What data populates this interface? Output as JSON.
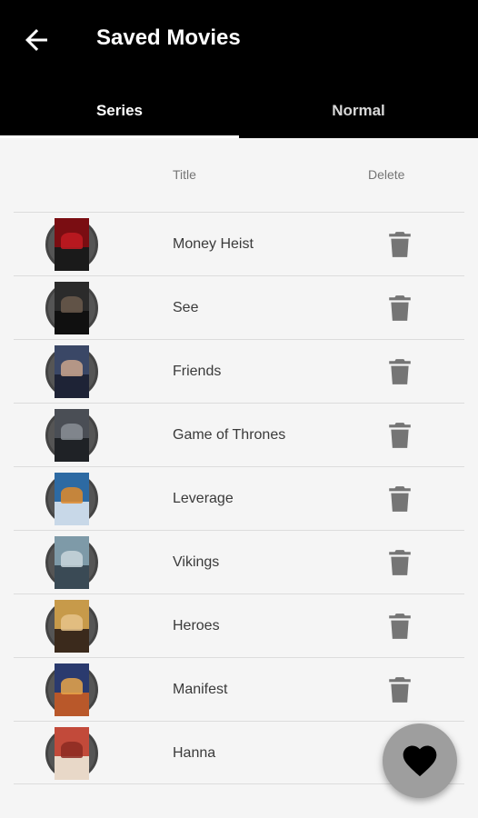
{
  "appbar": {
    "title": "Saved Movies",
    "back_icon": "arrow-back-icon",
    "background": "#000000"
  },
  "tabs": [
    {
      "label": "Series",
      "active": true
    },
    {
      "label": "Normal",
      "active": false
    }
  ],
  "table": {
    "headers": {
      "title": "Title",
      "delete": "Delete"
    }
  },
  "rows": [
    {
      "title": "Money Heist",
      "poster_colors": [
        "#7a0d12",
        "#1a1a1a",
        "#c21b22"
      ]
    },
    {
      "title": "See",
      "poster_colors": [
        "#2b2b2b",
        "#101010",
        "#6b5a4c"
      ]
    },
    {
      "title": "Friends",
      "poster_colors": [
        "#3a4766",
        "#1e2336",
        "#caa58c"
      ]
    },
    {
      "title": "Game of Thrones",
      "poster_colors": [
        "#4a4e55",
        "#1f2226",
        "#8a8f96"
      ]
    },
    {
      "title": "Leverage",
      "poster_colors": [
        "#2d6aa3",
        "#c8d8e8",
        "#e08a2a"
      ]
    },
    {
      "title": "Vikings",
      "poster_colors": [
        "#7e9aa8",
        "#3a4a55",
        "#c9d6dc"
      ]
    },
    {
      "title": "Heroes",
      "poster_colors": [
        "#c79a4a",
        "#3b2a1c",
        "#e6c38a"
      ]
    },
    {
      "title": "Manifest",
      "poster_colors": [
        "#2a3a6e",
        "#b9582a",
        "#e7a64a"
      ]
    },
    {
      "title": "Hanna",
      "poster_colors": [
        "#c24a3a",
        "#e8d8c8",
        "#8c2a22"
      ]
    }
  ],
  "row_icons": {
    "delete": "trash-icon"
  },
  "fab": {
    "icon": "heart-icon",
    "color": "#9e9e9e"
  }
}
